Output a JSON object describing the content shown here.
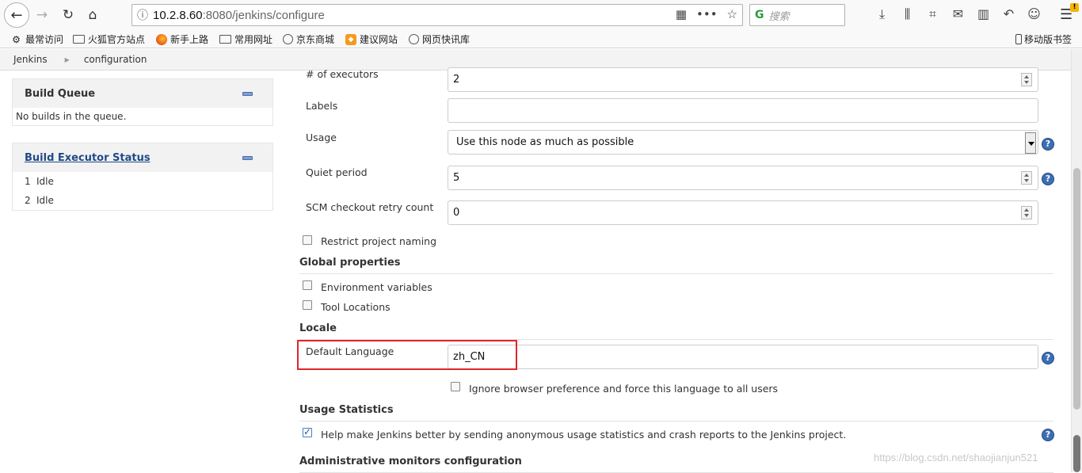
{
  "browser": {
    "url_host": "10.2.8.60",
    "url_rest": ":8080/jenkins/configure",
    "search_placeholder": "搜索",
    "bookmarks": [
      "最常访问",
      "火狐官方站点",
      "新手上路",
      "常用网址",
      "京东商城",
      "建议网站",
      "网页快讯库"
    ],
    "mobile_bookmarks": "移动版书签"
  },
  "breadcrumb": {
    "home": "Jenkins",
    "current": "configuration"
  },
  "sidebar": {
    "build_queue": {
      "title": "Build Queue",
      "empty": "No builds in the queue."
    },
    "executor_status": {
      "title": "Build Executor Status",
      "executors": [
        {
          "num": "1",
          "state": "Idle"
        },
        {
          "num": "2",
          "state": "Idle"
        }
      ]
    }
  },
  "form": {
    "executors": {
      "label": "# of executors",
      "value": "2"
    },
    "labels": {
      "label": "Labels",
      "value": ""
    },
    "usage": {
      "label": "Usage",
      "value": "Use this node as much as possible"
    },
    "quiet_period": {
      "label": "Quiet period",
      "value": "5"
    },
    "scm_retry": {
      "label": "SCM checkout retry count",
      "value": "0"
    },
    "restrict_naming": {
      "label": "Restrict project naming",
      "checked": false
    },
    "global_properties": {
      "title": "Global properties",
      "env_vars": {
        "label": "Environment variables",
        "checked": false
      },
      "tool_locations": {
        "label": "Tool Locations",
        "checked": false
      }
    },
    "locale": {
      "title": "Locale",
      "default_language": {
        "label": "Default Language",
        "value": "zh_CN"
      },
      "ignore_browser": {
        "label": "Ignore browser preference and force this language to all users",
        "checked": false
      }
    },
    "usage_statistics": {
      "title": "Usage Statistics",
      "help_jenkins": {
        "label": "Help make Jenkins better by sending anonymous usage statistics and crash reports to the Jenkins project.",
        "checked": true
      }
    },
    "admin_monitors": {
      "title": "Administrative monitors configuration"
    }
  },
  "watermark": "https://blog.csdn.net/shaojianjun521",
  "colors": {
    "accent": "#3c6eb4",
    "highlight": "#e0262a",
    "link": "#204a87"
  }
}
